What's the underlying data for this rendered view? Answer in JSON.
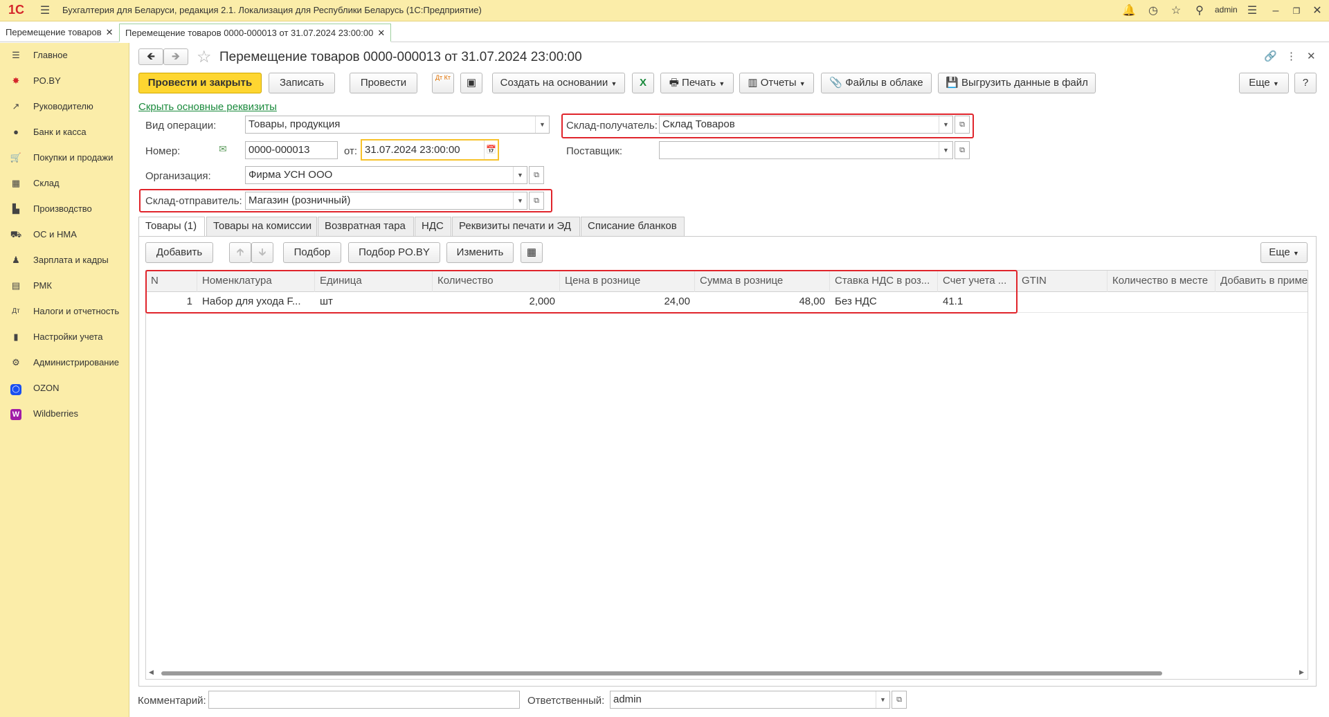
{
  "window": {
    "title": "Бухгалтерия для Беларуси, редакция 2.1. Локализация для Республики Беларусь  (1С:Предприятие)",
    "user": "admin",
    "logo_text": "1С"
  },
  "tabs": [
    {
      "label": "Перемещение товаров"
    },
    {
      "label": "Перемещение товаров 0000-000013 от 31.07.2024 23:00:00"
    }
  ],
  "sidebar": {
    "items": [
      {
        "label": "Главное"
      },
      {
        "label": "PO.BY"
      },
      {
        "label": "Руководителю"
      },
      {
        "label": "Банк и касса"
      },
      {
        "label": "Покупки и продажи"
      },
      {
        "label": "Склад"
      },
      {
        "label": "Производство"
      },
      {
        "label": "ОС и НМА"
      },
      {
        "label": "Зарплата и кадры"
      },
      {
        "label": "РМК"
      },
      {
        "label": "Налоги и отчетность"
      },
      {
        "label": "Настройки учета"
      },
      {
        "label": "Администрирование"
      },
      {
        "label": "OZON"
      },
      {
        "label": "Wildberries"
      }
    ]
  },
  "form": {
    "title": "Перемещение товаров 0000-000013 от 31.07.2024 23:00:00",
    "toolbar": {
      "post_close": "Провести и закрыть",
      "save": "Записать",
      "post": "Провести",
      "create_based": "Создать на основании",
      "print": "Печать",
      "reports": "Отчеты",
      "cloud_files": "Файлы в облаке",
      "export": "Выгрузить данные в файл",
      "more": "Еще",
      "help": "?",
      "dt_kt": "Дт Кт"
    },
    "hide_link": "Скрыть основные реквизиты",
    "fields": {
      "operation_label": "Вид операции:",
      "operation_value": "Товары, продукция",
      "number_label": "Номер:",
      "number_value": "0000-000013",
      "date_label": "от:",
      "date_value": "31.07.2024 23:00:00",
      "org_label": "Организация:",
      "org_value": "Фирма УСН ООО",
      "sender_label": "Склад-отправитель:",
      "sender_value": "Магазин (розничный)",
      "receiver_label": "Склад-получатель:",
      "receiver_value": "Склад Товаров",
      "supplier_label": "Поставщик:",
      "supplier_value": "",
      "comment_label": "Комментарий:",
      "comment_value": "",
      "responsible_label": "Ответственный:",
      "responsible_value": "admin"
    },
    "doc_tabs": [
      {
        "label": "Товары (1)"
      },
      {
        "label": "Товары на комиссии"
      },
      {
        "label": "Возвратная тара"
      },
      {
        "label": "НДС"
      },
      {
        "label": "Реквизиты печати и ЭД"
      },
      {
        "label": "Списание бланков"
      }
    ],
    "table_toolbar": {
      "add": "Добавить",
      "pick": "Подбор",
      "pick_poby": "Подбор PO.BY",
      "change": "Изменить",
      "more": "Еще"
    },
    "table": {
      "columns": [
        "N",
        "Номенклатура",
        "Единица",
        "Количество",
        "Цена в рознице",
        "Сумма в рознице",
        "Ставка НДС в роз...",
        "Счет учета ...",
        "GTIN",
        "Количество в месте",
        "Добавить в приме"
      ],
      "rows": [
        [
          "1",
          "Набор для ухода F...",
          "шт",
          "2,000",
          "24,00",
          "48,00",
          "Без НДС",
          "41.1",
          "",
          "",
          ""
        ]
      ]
    }
  },
  "colors": {
    "sidebar_bg": "#fbeda9",
    "primary_button": "#fed631",
    "highlight_red": "#e0242b",
    "link_green": "#1a8a3c"
  }
}
